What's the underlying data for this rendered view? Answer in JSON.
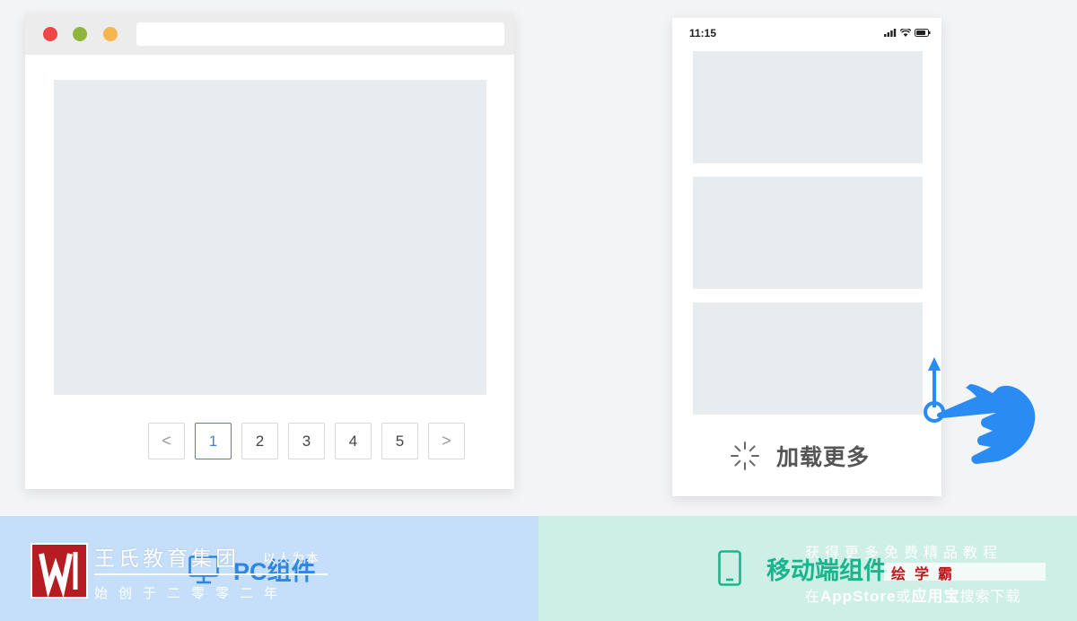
{
  "pc": {
    "pagination": {
      "prev": "<",
      "pages": [
        "1",
        "2",
        "3",
        "4",
        "5"
      ],
      "next": ">",
      "active_page": "1"
    },
    "label": "PC组件"
  },
  "mobile": {
    "status_time": "11:15",
    "load_more": "加载更多",
    "label": "移动端组件"
  },
  "watermark": {
    "group_name": "王氏教育集团",
    "slogan": "以人为本",
    "since": "始创于二零零二年",
    "promo": "获得更多免费精品教程",
    "site": "绘学霸",
    "store_prefix": "在",
    "store_appstore": "AppStore",
    "store_or": "或",
    "store_yyb": "应用宝",
    "store_suffix": "搜索下载"
  },
  "colors": {
    "pc_accent": "#2e86de",
    "mobile_accent": "#1bb58d",
    "hand": "#2a8bf2",
    "left_panel_bg": "#c5dffa",
    "right_panel_bg": "#cdefe6",
    "placeholder_block": "#e9ecef"
  },
  "icons": [
    "monitor-icon",
    "phone-icon",
    "spinner-icon",
    "hand-swipe-icon",
    "signal-icon",
    "wifi-icon",
    "battery-icon"
  ]
}
